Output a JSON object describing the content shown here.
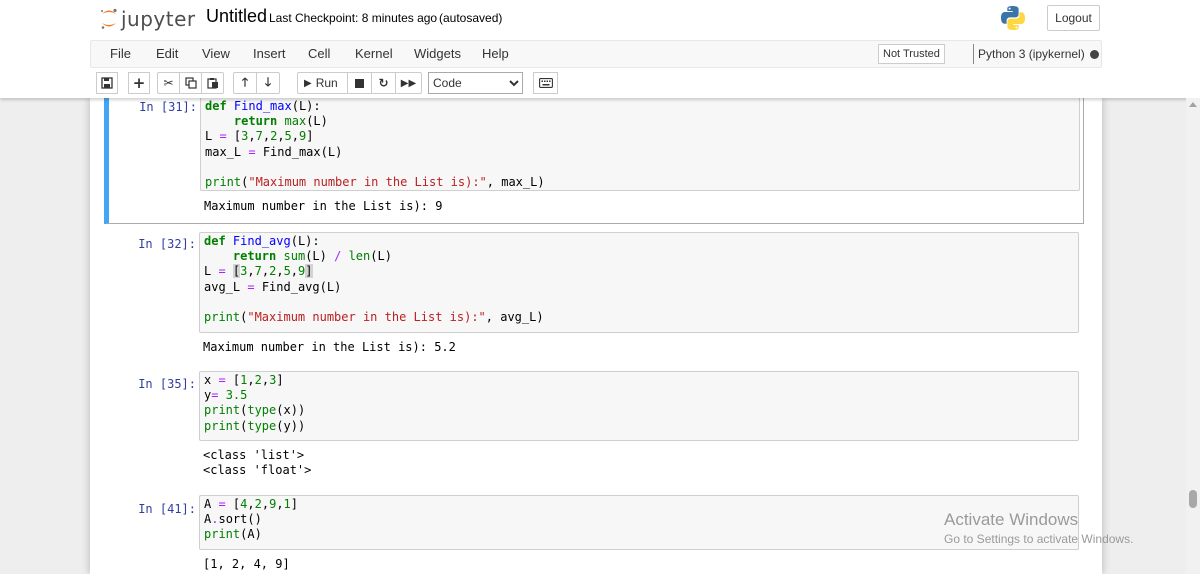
{
  "header": {
    "logo_text": "jupyter",
    "notebook_name": "Untitled",
    "checkpoint": "Last Checkpoint: 8 minutes ago",
    "autosave": "(autosaved)",
    "logout_label": "Logout"
  },
  "menubar": {
    "items": [
      "File",
      "Edit",
      "View",
      "Insert",
      "Cell",
      "Kernel",
      "Widgets",
      "Help"
    ],
    "trust_label": "Not Trusted",
    "kernel_label": "Python 3 (ipykernel)"
  },
  "toolbar": {
    "run_label": "Run",
    "cell_type_options": [
      "Code"
    ]
  },
  "cells": [
    {
      "prompt": "In [31]:",
      "code": [
        "def Find_max(L):",
        "    return max(L)",
        "L = [3,7,2,5,9]",
        "max_L = Find_max(L)",
        "",
        "print(\"Maximum number in the List is):\", max_L)"
      ],
      "output": [
        "Maximum number in the List is): 9"
      ]
    },
    {
      "prompt": "In [32]:",
      "code": [
        "def Find_avg(L):",
        "    return sum(L) / len(L)",
        "L = [3,7,2,5,9]",
        "avg_L = Find_avg(L)",
        "",
        "print(\"Maximum number in the List is):\", avg_L)"
      ],
      "output": [
        "Maximum number in the List is): 5.2"
      ]
    },
    {
      "prompt": "In [35]:",
      "code": [
        "x = [1,2,3]",
        "y= 3.5",
        "print(type(x))",
        "print(type(y))"
      ],
      "output": [
        "<class 'list'>",
        "<class 'float'>"
      ]
    },
    {
      "prompt": "In [41]:",
      "code": [
        "A = [4,2,9,1]",
        "A.sort()",
        "print(A)"
      ],
      "output": [
        "[1, 2, 4, 9]"
      ]
    }
  ],
  "watermark": {
    "title": "Activate Windows",
    "subtitle": "Go to Settings to activate Windows."
  },
  "colors": {
    "selected_cell_border": "#42a5f5",
    "prompt": "#303f9f",
    "keyword": "#008000",
    "function_name": "#0000ff",
    "string": "#ba2121",
    "operator": "#aa22ff"
  }
}
